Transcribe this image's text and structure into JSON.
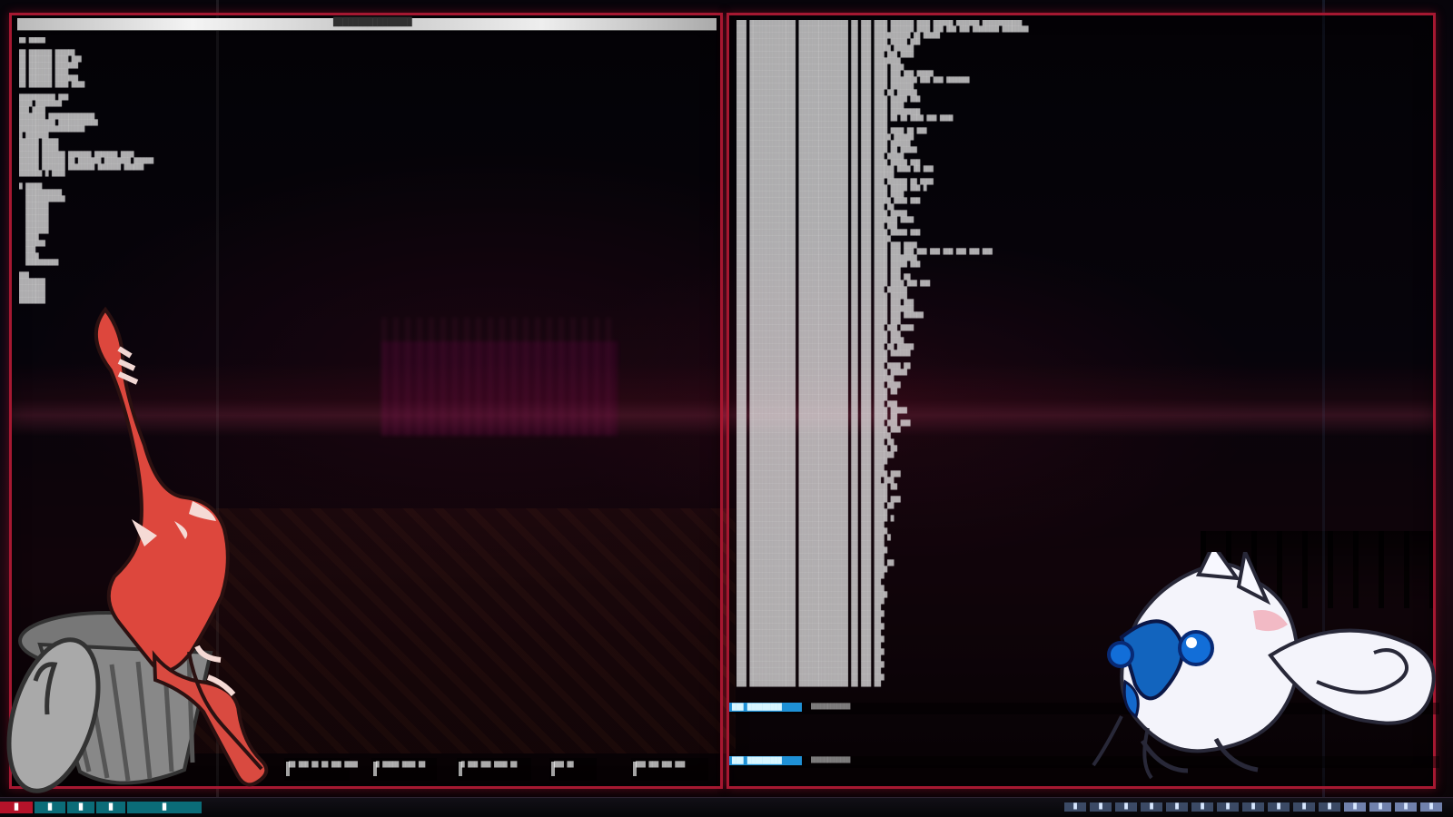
{
  "desktop": {
    "theme_colors": {
      "accent": "#a51831",
      "terminal_text": "#e6e6e6",
      "status_blue": "#1f91d6",
      "taskbar_red": "#b5132a",
      "taskbar_blue": "#0b6c78"
    }
  },
  "left_window": {
    "title": "████████████████"
  },
  "terminals": {
    "left_lines": [
      "██ █████",
      "",
      "██ ███████ ██████",
      "██ ███████ ████ ███",
      "██ ███████ ███████",
      "██ ███████ ████",
      "██ ███████ ███████",
      "██ ███████ ████ ████",
      "",
      "███████████ ███",
      "████ ████████",
      "███ ████",
      "████████ ██████████████",
      "███████████ ████████████",
      "████████████████████",
      "█ ███████",
      "██████ █████",
      "██████ █████",
      "██████ ███████ ███████ ███████ ████",
      "██████ ███████ ██ ███████ ████████ ██████",
      "██████ ███████ ████████ ███████ ██████",
      "███████ █ ████",
      "",
      "█ █████",
      "  ███████████",
      "  ████████████",
      "  ███████",
      "  ███████",
      "  ███████",
      "  ███████",
      "  ███████",
      "  ████",
      "  ██████",
      "  ███",
      "  ████",
      "  ██████████",
      "",
      "███",
      "████████",
      "████████",
      "████████",
      "████████"
    ],
    "right_lines": [
      "███ ██████████████ ███████████████ ██ ███ ████ ███████ ████ ██████ ███████ ████████████",
      "███ ██████████████ ███████████████ ██ ███ ████ ███████ ████ ███ ███ ███ ████████ ████████",
      "███ ██████████████ ███████████████ ██ ███ ███████████ ██ █████",
      "███ ██████████████ ███████████████ ██ ███ ████ █████ ███",
      "███ ██████████████ ███████████████ ██ ███ █████ ██████",
      "███ ██████████████ ███████████████ ██ ███ ███ ███ ████",
      "███ ██████████████ ███████████████ ██ ███ ████████",
      "███ ██████████████ ███████████████ ██ ███ ████ ████",
      "███ ██████████████ ███████████████ ██ ███ ████ ███ ███ █████",
      "███ ██████████████ ███████████████ ██ ███ ████ ████████ ███ ███ ███████",
      "███ ██████████████ ███████████████ ██ ███ ████ ███████",
      "███ ██████████████ ███████████████ ██ ███ ███ ██ ██████",
      "███ ██████████████ ███████████████ ██ ███ ████ █████ ███",
      "███ ██████████████ ███████████████ ██ ███ ████ ████",
      "███ ██████████████ ███████████████ ██ ███ ████ █████████",
      "███ ██████████████ ███████████████ ██ ███ ████ ██ ██ ████ ███ ████",
      "███ ██████████████ ███████████████ ██ ███ ████",
      "███ ██████████████ ███████████████ ██ ███ ████ ████ ██ ███",
      "███ ██████████████ ███████████████ ██ ███ █████ ██████",
      "███ ██████████████ ███████████████ ██ ███ ████ ██████",
      "███ ██████████████ ███████████████ ██ ███ ████ ██ █████",
      "███ ██████████████ ███████████████ ██ ███ ███ █████",
      "███ ██████████████ ███████████████ ██ ███ ████ █████ ███",
      "███ ██████████████ ███████████████ ██ ███ ██████ ████ ██ ███",
      "███ ██████████████ ███████████████ ██ ███ ██████",
      "███ ██████████████ ███████████████ ██ ███ ███ ██████ ██ ████",
      "███ ██████████████ ███████████████ ██ ███ ████ █████ ███ █",
      "███ ██████████████ ███████████████ ██ ███ ████ ████",
      "███ ██████████████ ███████████████ ██ ███ █████ ████ ███",
      "███ ██████████████ ███████████████ ██ ███ ███ ██",
      "███ ██████████████ ███████████████ ██ ███ ████ █████",
      "███ ██████████████ ███████████████ ██ ███ ███████ ████",
      "███ ██████████████ ███████████████ ██ ███ ███ ███",
      "███ ██████████████ ███████████████ ██ ███ ████ █████ ███",
      "███ ██████████████ ███████████████ ██ ███ █████",
      "███ ██████████████ ███████████████ ██ ███ ████ ███ ████",
      "███ ██████████████ ███████████████ ██ ███ ████ ███ ███ ███ ███ ███ ███ ███ ███",
      "███ ██████████████ ███████████████ ██ ███ ████ ████████",
      "███ ██████████████ ███████████████ ██ ███ ████ █████ ███",
      "███ ██████████████ ███████████████ ██ ███ ████ ███",
      "███ ██████████████ ███████████████ ██ ███ ████ ███ ██",
      "███ ██████████████ ███████████████ ██ ███ ████ ████ ███ ███",
      "███ ██████████████ ███████████████ ██ ███ ███ ██████",
      "███ ██████████████ ███████████████ ██ ███ ████ █████",
      "███ ██████████████ ███████████████ ██ ███ ████ ███ ███",
      "███ ██████████████ ███████████████ ██ ███ ████ ███████",
      "███ ██████████████ ███████████████ ██ ███ ████ ███ ██████",
      "███ ██████████████ ███████████████ ██ ███ ████ ███",
      "███ ██████████████ ███████████████ ██ ███ ███ ███ ████",
      "███ ██████████████ ███████████████ ██ ███ ████ ███",
      "███ ██████████████ ███████████████ ██ ███ ████ ████",
      "███ ██████████████ ███████████████ ██ ███ ███ ██ █████",
      "███ ██████████████ ███████████████ ██ ███ ████ ██████",
      "███ ██████████████ ███████████████ ██ ███ ████",
      "███ ██████████████ ███████████████ ██ ███ ███ ████ ██",
      "███ ██████████████ ███████████████ ██ ███ ████ █████",
      "███ ██████████████ ███████████████ ██ ███ ██████",
      "███ ██████████████ ███████████████ ██ ███ ███ ████",
      "███ ██████████████ ███████████████ ██ ███ ████ ██",
      "███ ██████████████ ███████████████ ██ ███ ████",
      "███ ██████████████ ███████████████ ██ ███ ███ ███",
      "███ ██████████████ ███████████████ ██ ███ ████ █████",
      "███ ██████████████ ███████████████ ██ ███ ████ ██",
      "███ ██████████████ ███████████████ ██ ███ ███ ███ ███",
      "███ ██████████████ ███████████████ ██ ███ ████ ███",
      "███ ██████████████ ███████████████ ██ ███ █████",
      "███ ██████████████ ███████████████ ██ ███ ███ ██",
      "███ ██████████████ ███████████████ ██ ███ ████ ██",
      "███ ██████████████ ███████████████ ██ ███ ██████",
      "███ ██████████████ ███████████████ ██ ███ ████",
      "███ ██████████████ ███████████████ ██ ███ ███",
      "███ ██████████████ ███████████████ ██ ███ ████ ███",
      "███ ██████████████ ███████████████ ██ ███ ██ ███",
      "███ ██████████████ ███████████████ ██ ███ ████ ██",
      "███ ██████████████ ███████████████ ██ ███ ████",
      "███ ██████████████ ███████████████ ██ ███ ████ ███",
      "███ ██████████████ ███████████████ ██ ███ ███ ██",
      "███ ██████████████ ███████████████ ██ ███ ████",
      "███ ██████████████ ███████████████ ██ ███ ████ █",
      "███ ██████████████ ███████████████ ██ ███ ███",
      "███ ██████████████ ███████████████ ██ ███ ████",
      "███ ██████████████ ███████████████ ██ ███ ███ █",
      "███ ██████████████ ███████████████ ██ ███ ███",
      "███ ██████████████ ███████████████ ██ ███ ████",
      "███ ██████████████ ███████████████ ██ ███ ███",
      "███ ██████████████ ███████████████ ██ ███ ███ ██",
      "███ ██████████████ ███████████████ ██ ███ ████",
      "███ ██████████████ ███████████████ ██ ███ ███",
      "███ ██████████████ ███████████████ ██ ███ ██",
      "███ ██████████████ ███████████████ ██ ███ ███",
      "███ ██████████████ ███████████████ ██ ███ ████",
      "███ ██████████████ ███████████████ ██ ███ ███",
      "███ ██████████████ ███████████████ ██ ███ ██",
      "███ ██████████████ ███████████████ ██ ███ ███",
      "███ ██████████████ ███████████████ ██ ███ ██",
      "███ ██████████████ ███████████████ ██ ███ ███",
      "███ ██████████████ ███████████████ ██ ███ ██",
      "███ ██████████████ ███████████████ ██ ███ ███",
      "███ ██████████████ ███████████████ ██ ███ ██",
      "███ ██████████████ ███████████████ ██ ███ ███",
      "███ ██████████████ ███████████████ ██ ███ ██",
      "███ ██████████████ ███████████████ ██ ███ ███",
      "███ ██████████████ ███████████████ ██ ███ ██",
      "███ ██████████████ ███████████████ ██ ███ ███",
      "███ ██████████████ ███████████████ ██ ███ ██"
    ]
  },
  "status": {
    "upper_tag": "███ █████████",
    "upper_label": "████████████",
    "lower_tag": "███ █████████",
    "lower_label": "████████████"
  },
  "widgets": [
    {
      "label": "██ ███ ██\n██ ███ ████"
    },
    {
      "label": "█ █████\n████ ██"
    },
    {
      "label": "█ ███ ███\n████ ██"
    },
    {
      "label": "███\n██"
    },
    {
      "label": "███ ███\n███ ███"
    }
  ],
  "taskbar": {
    "tabs": [
      {
        "label": "█",
        "color": "#b5132a"
      },
      {
        "label": "█",
        "color": "#0b6c78"
      },
      {
        "label": "█",
        "color": "#0b6c78"
      },
      {
        "label": "█",
        "color": "#0b6c78"
      },
      {
        "label": "█",
        "color": "#0b6c78"
      }
    ],
    "tray_items": [
      "█",
      "█",
      "█",
      "█",
      "█",
      "█",
      "█",
      "█",
      "█",
      "█",
      "█",
      "█",
      "█",
      "█",
      "█"
    ]
  }
}
